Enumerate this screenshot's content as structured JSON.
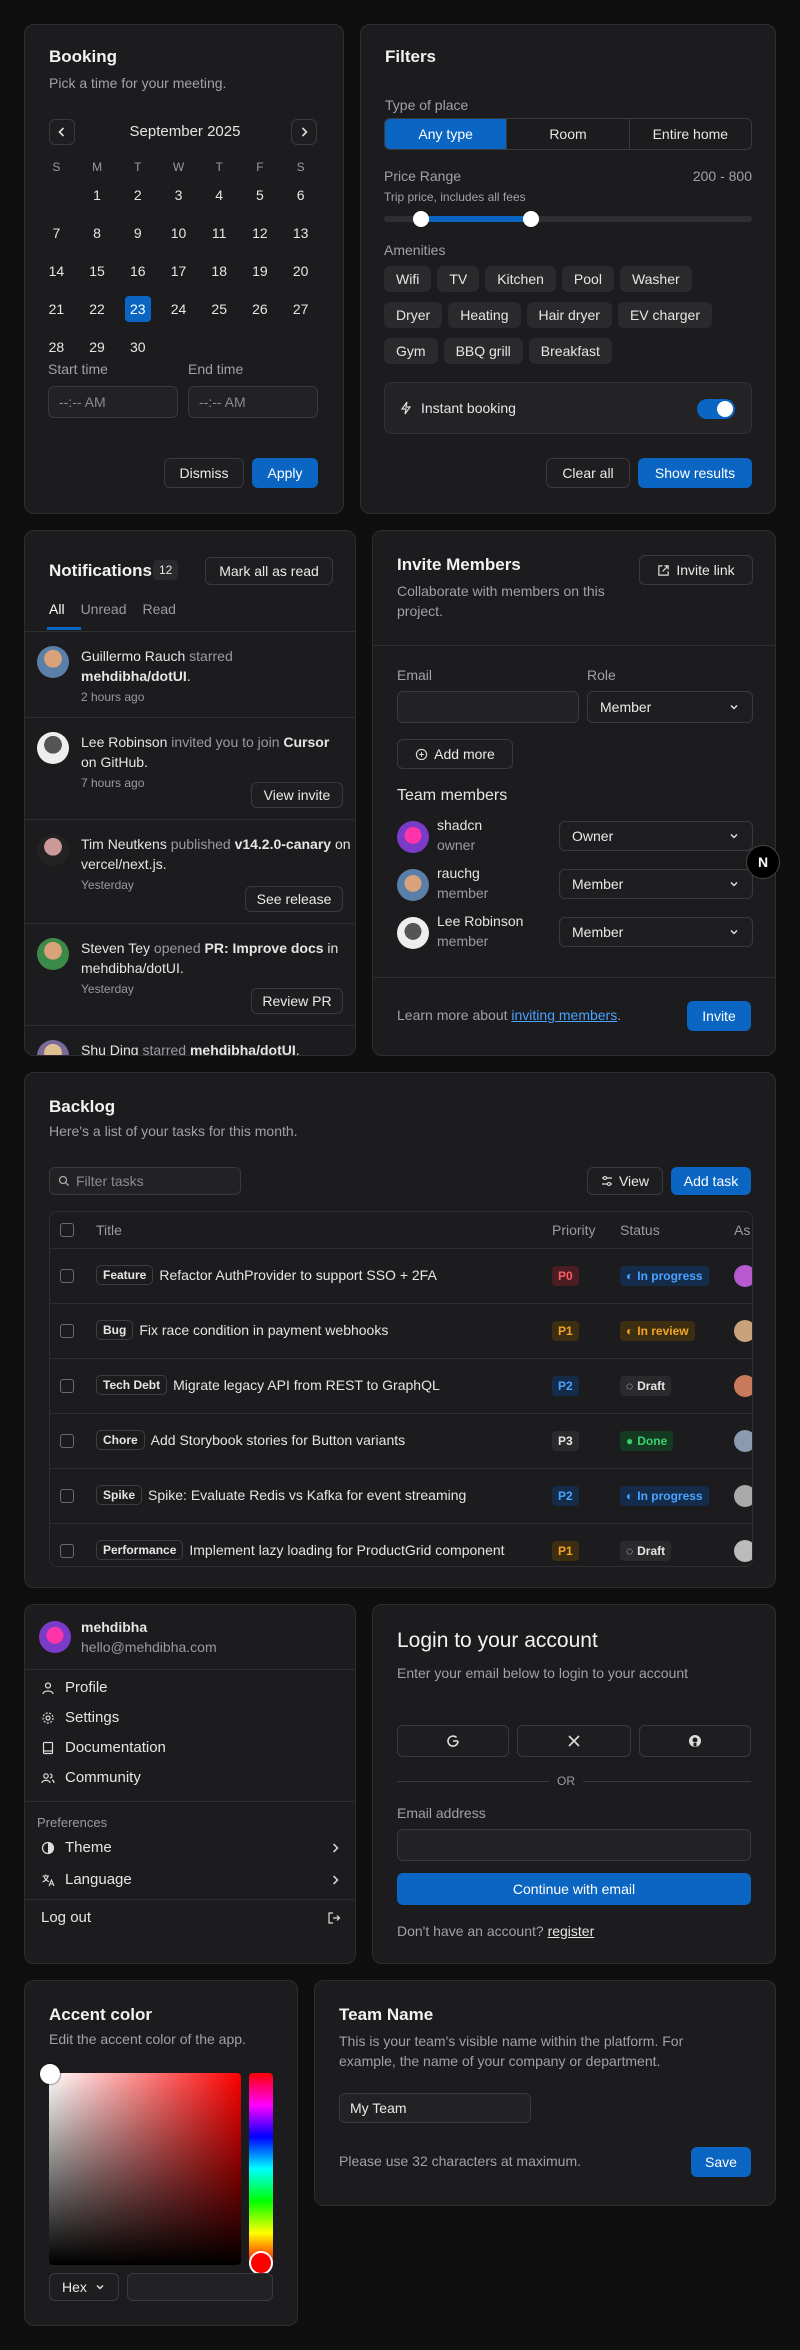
{
  "booking": {
    "title": "Booking",
    "subtitle": "Pick a time for your meeting.",
    "month": "September 2025",
    "weekdays": [
      "S",
      "M",
      "T",
      "W",
      "T",
      "F",
      "S"
    ],
    "days": [
      "",
      "1",
      "2",
      "3",
      "4",
      "5",
      "6",
      "7",
      "8",
      "9",
      "10",
      "11",
      "12",
      "13",
      "14",
      "15",
      "16",
      "17",
      "18",
      "19",
      "20",
      "21",
      "22",
      "23",
      "24",
      "25",
      "26",
      "27",
      "28",
      "29",
      "30",
      "",
      "",
      "",
      ""
    ],
    "selected_day": "23",
    "start_label": "Start time",
    "end_label": "End time",
    "start_placeholder": "--:-- AM",
    "end_placeholder": "--:-- AM",
    "dismiss": "Dismiss",
    "apply": "Apply"
  },
  "filters": {
    "title": "Filters",
    "type_label": "Type of place",
    "types": [
      "Any type",
      "Room",
      "Entire home"
    ],
    "active_type": "Any type",
    "price_label": "Price Range",
    "price_range": "200 - 800",
    "price_sub": "Trip price, includes all fees",
    "price_min_fraction": 0.1,
    "price_max_fraction": 0.4,
    "amenities_label": "Amenities",
    "amenities": [
      "Wifi",
      "TV",
      "Kitchen",
      "Pool",
      "Washer",
      "Dryer",
      "Heating",
      "Hair dryer",
      "EV charger",
      "Gym",
      "BBQ grill",
      "Breakfast"
    ],
    "instant_label": "Instant booking",
    "instant_on": true,
    "clear": "Clear all",
    "show": "Show results"
  },
  "notifications": {
    "title": "Notifications",
    "count": "12",
    "mark": "Mark all as read",
    "tabs": [
      "All",
      "Unread",
      "Read"
    ],
    "items": [
      {
        "who": "Guillermo Rauch",
        "action": " starred ",
        "target": "mehdibha/dotUI",
        "tail": ".",
        "time": "2 hours ago",
        "button": ""
      },
      {
        "who": "Lee Robinson",
        "action": " invited you to join ",
        "target": "Cursor",
        "tail": " on GitHub.",
        "time": "7 hours ago",
        "button": "View invite"
      },
      {
        "who": "Tim Neutkens",
        "action": " published ",
        "target": "v14.2.0-canary",
        "tail": " on vercel/next.js.",
        "time": "Yesterday",
        "button": "See release"
      },
      {
        "who": "Steven Tey",
        "action": " opened ",
        "target": "PR: Improve docs",
        "tail": " in mehdibha/dotUI.",
        "time": "Yesterday",
        "button": "Review PR"
      },
      {
        "who": "Shu Ding",
        "action": " starred ",
        "target": "mehdibha/dotUI",
        "tail": ".",
        "time": "",
        "button": ""
      }
    ]
  },
  "invite": {
    "title": "Invite Members",
    "subtitle": "Collaborate with members on this project.",
    "link": "Invite link",
    "email_label": "Email",
    "role_label": "Role",
    "role_value": "Member",
    "add_more": "Add more",
    "team_label": "Team members",
    "members": [
      {
        "name": "shadcn",
        "role": "owner",
        "select": "Owner"
      },
      {
        "name": "rauchg",
        "role": "member",
        "select": "Member"
      },
      {
        "name": "Lee Robinson",
        "role": "member",
        "select": "Member"
      }
    ],
    "footer_text": "Learn more about ",
    "footer_link": "inviting members",
    "footer_end": ".",
    "invite_button": "Invite"
  },
  "backlog": {
    "title": "Backlog",
    "subtitle": "Here's a list of your tasks for this month.",
    "filter_placeholder": "Filter tasks",
    "view": "View",
    "add": "Add task",
    "columns": [
      "Title",
      "Priority",
      "Status",
      "As"
    ],
    "rows": [
      {
        "tag": "Feature",
        "title": "Refactor AuthProvider to support SSO + 2FA",
        "priority": "P0",
        "status": "In progress"
      },
      {
        "tag": "Bug",
        "title": "Fix race condition in payment webhooks",
        "priority": "P1",
        "status": "In review"
      },
      {
        "tag": "Tech Debt",
        "title": "Migrate legacy API from REST to GraphQL",
        "priority": "P2",
        "status": "Draft"
      },
      {
        "tag": "Chore",
        "title": "Add Storybook stories for Button variants",
        "priority": "P3",
        "status": "Done"
      },
      {
        "tag": "Spike",
        "title": "Spike: Evaluate Redis vs Kafka for event streaming",
        "priority": "P2",
        "status": "In progress"
      },
      {
        "tag": "Performance",
        "title": "Implement lazy loading for ProductGrid component",
        "priority": "P1",
        "status": "Draft"
      }
    ]
  },
  "user_menu": {
    "name": "mehdibha",
    "email": "hello@mehdibha.com",
    "items": [
      "Profile",
      "Settings",
      "Documentation",
      "Community"
    ],
    "prefs_label": "Preferences",
    "theme": "Theme",
    "language": "Language",
    "logout": "Log out"
  },
  "login": {
    "title": "Login to your account",
    "subtitle": "Enter your email below to login to your account",
    "or": "OR",
    "email_label": "Email address",
    "continue": "Continue with email",
    "no_account": "Don't have an account? ",
    "register": "register"
  },
  "accent": {
    "title": "Accent color",
    "subtitle": "Edit the accent color of the app.",
    "format": "Hex",
    "hue_color": "#ff0000"
  },
  "team": {
    "title": "Team Name",
    "subtitle": "This is your team's visible name within the platform. For example, the name of your company or department.",
    "value": "My Team",
    "hint": "Please use 32 characters at maximum.",
    "save": "Save"
  },
  "fab": {
    "label": "N"
  }
}
